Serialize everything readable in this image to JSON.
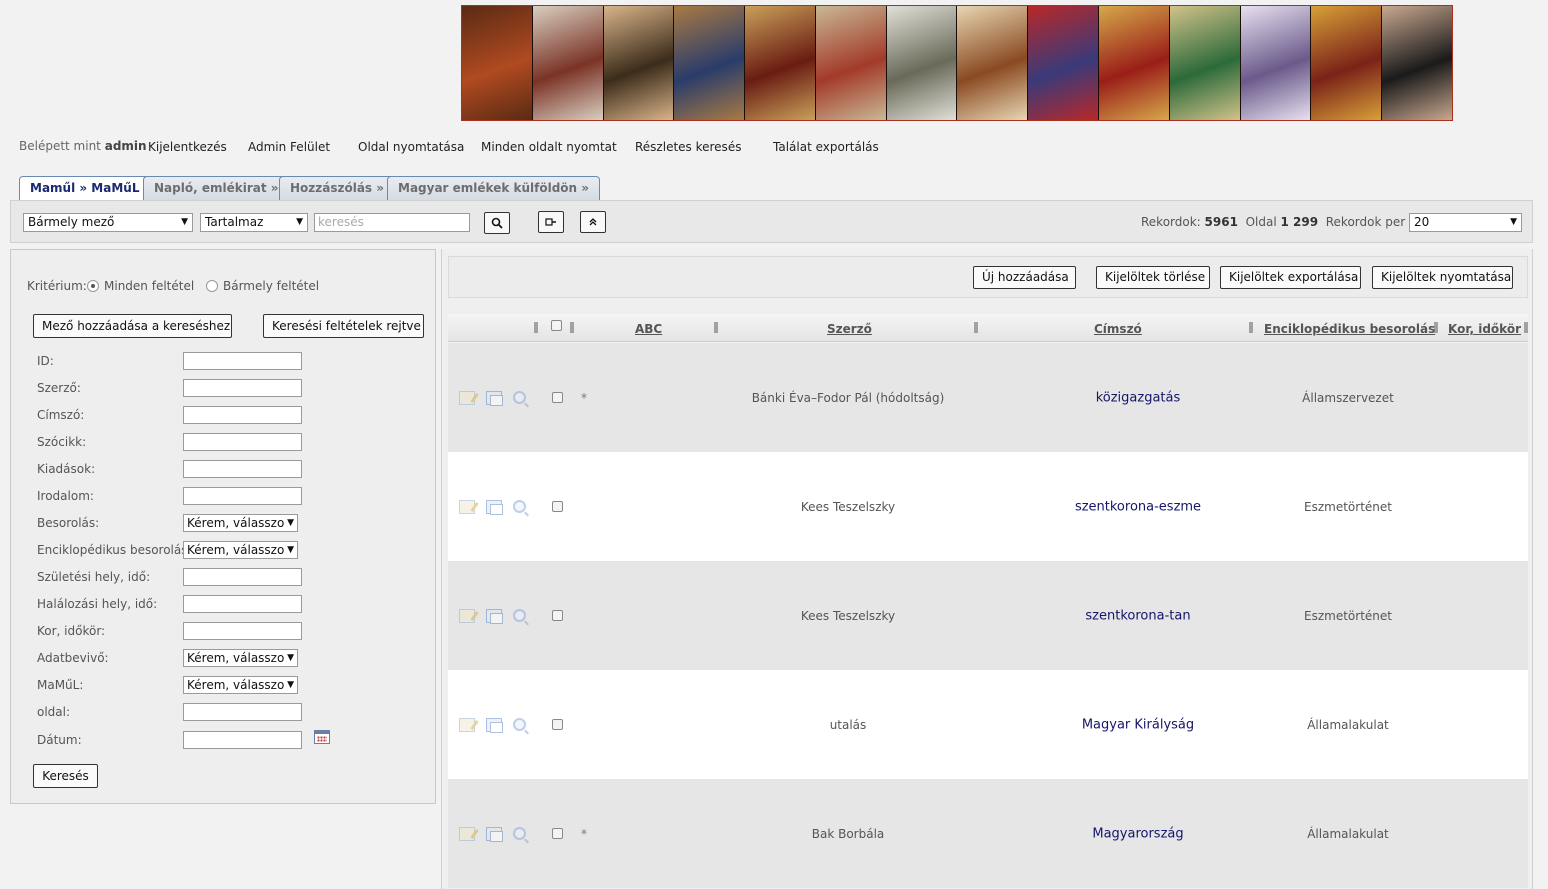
{
  "banner_panels": [
    {
      "color_a": "#b04a20",
      "color_b": "#5a2a14"
    },
    {
      "color_a": "#7a3326",
      "color_b": "#d8cfc0"
    },
    {
      "color_a": "#3b2c1a",
      "color_b": "#d9b48a"
    },
    {
      "color_a": "#2a3c6a",
      "color_b": "#a87a44"
    },
    {
      "color_a": "#6a1c12",
      "color_b": "#c9a05a"
    },
    {
      "color_a": "#a33a2a",
      "color_b": "#c8b894"
    },
    {
      "color_a": "#6a6a5a",
      "color_b": "#e0e0d8"
    },
    {
      "color_a": "#8a4a22",
      "color_b": "#e7d6b2"
    },
    {
      "color_a": "#3a3a7a",
      "color_b": "#b82828"
    },
    {
      "color_a": "#9a1e18",
      "color_b": "#d6a84a"
    },
    {
      "color_a": "#2c6a3a",
      "color_b": "#d2c28a"
    },
    {
      "color_a": "#6a5a8a",
      "color_b": "#e8e0f0"
    },
    {
      "color_a": "#7a2218",
      "color_b": "#d7a038"
    },
    {
      "color_a": "#1a1a1a",
      "color_b": "#c9a890"
    }
  ],
  "topmenu": {
    "logged_prefix": "Belépett mint",
    "user": "admin",
    "links": [
      "Kijelentkezés",
      "Admin Felület",
      "Oldal nyomtatása",
      "Minden oldalt nyomtat",
      "Részletes keresés",
      "Találat exportálás"
    ]
  },
  "tabs": [
    "Maműl » MaMűL",
    "Napló, emlékirat »",
    "Hozzászólás »",
    "Magyar emlékek külföldön »"
  ],
  "searchbar": {
    "field_select": "Bármely mező",
    "operator_select": "Tartalmaz",
    "search_placeholder": "keresés",
    "records_label": "Rekordok:",
    "records_count": "5961",
    "page_label": "Oldal",
    "page_value": "1 299",
    "per_page_label": "Rekordok per lap:",
    "per_page_value": "20"
  },
  "leftpanel": {
    "criteria_label": "Kritérium:",
    "radio_all": "Minden feltétel",
    "radio_any": "Bármely feltétel",
    "add_field_btn": "Mező hozzáadása a kereséshez",
    "hide_criteria_btn": "Keresési feltételek rejtve",
    "fields": [
      {
        "label": "ID:",
        "type": "input"
      },
      {
        "label": "Szerző:",
        "type": "input"
      },
      {
        "label": "Címszó:",
        "type": "input"
      },
      {
        "label": "Szócikk:",
        "type": "input"
      },
      {
        "label": "Kiadások:",
        "type": "input"
      },
      {
        "label": "Irodalom:",
        "type": "input"
      },
      {
        "label": "Besorolás:",
        "type": "select",
        "value": "Kérem, válasszon"
      },
      {
        "label": "Enciklopédikus besorolás:",
        "type": "select",
        "value": "Kérem, válasszon"
      },
      {
        "label": "Születési hely, idő:",
        "type": "input"
      },
      {
        "label": "Halálozási hely, idő:",
        "type": "input"
      },
      {
        "label": "Kor, időkör:",
        "type": "input"
      },
      {
        "label": "Adatbevivő:",
        "type": "select",
        "value": "Kérem, válasszon"
      },
      {
        "label": "MaMűL:",
        "type": "select",
        "value": "Kérem, válasszon"
      },
      {
        "label": "oldal:",
        "type": "input"
      },
      {
        "label": "Dátum:",
        "type": "date"
      }
    ],
    "search_btn": "Keresés"
  },
  "actions": [
    "Új hozzáadása",
    "Kijelöltek törlése",
    "Kijelöltek exportálása",
    "Kijelöltek nyomtatása"
  ],
  "grid": {
    "columns": [
      "ABC",
      "Szerző",
      "Címszó",
      "Enciklopédikus besorolás",
      "Kor, időkör"
    ],
    "rows": [
      {
        "star": "*",
        "szerzo": "Bánki Éva–Fodor Pál (hódoltság)",
        "cimszo": "közigazgatás",
        "besorolas": "Államszervezet"
      },
      {
        "star": "",
        "szerzo": "Kees Teszelszky",
        "cimszo": "szentkorona-eszme",
        "besorolas": "Eszmetörténet"
      },
      {
        "star": "",
        "szerzo": "Kees Teszelszky",
        "cimszo": "szentkorona-tan",
        "besorolas": "Eszmetörténet"
      },
      {
        "star": "",
        "szerzo": "utalás",
        "cimszo": "Magyar Királyság",
        "besorolas": "Államalakulat"
      },
      {
        "star": "*",
        "szerzo": "Bak Borbála",
        "cimszo": "Magyarország",
        "besorolas": "Államalakulat"
      }
    ]
  }
}
